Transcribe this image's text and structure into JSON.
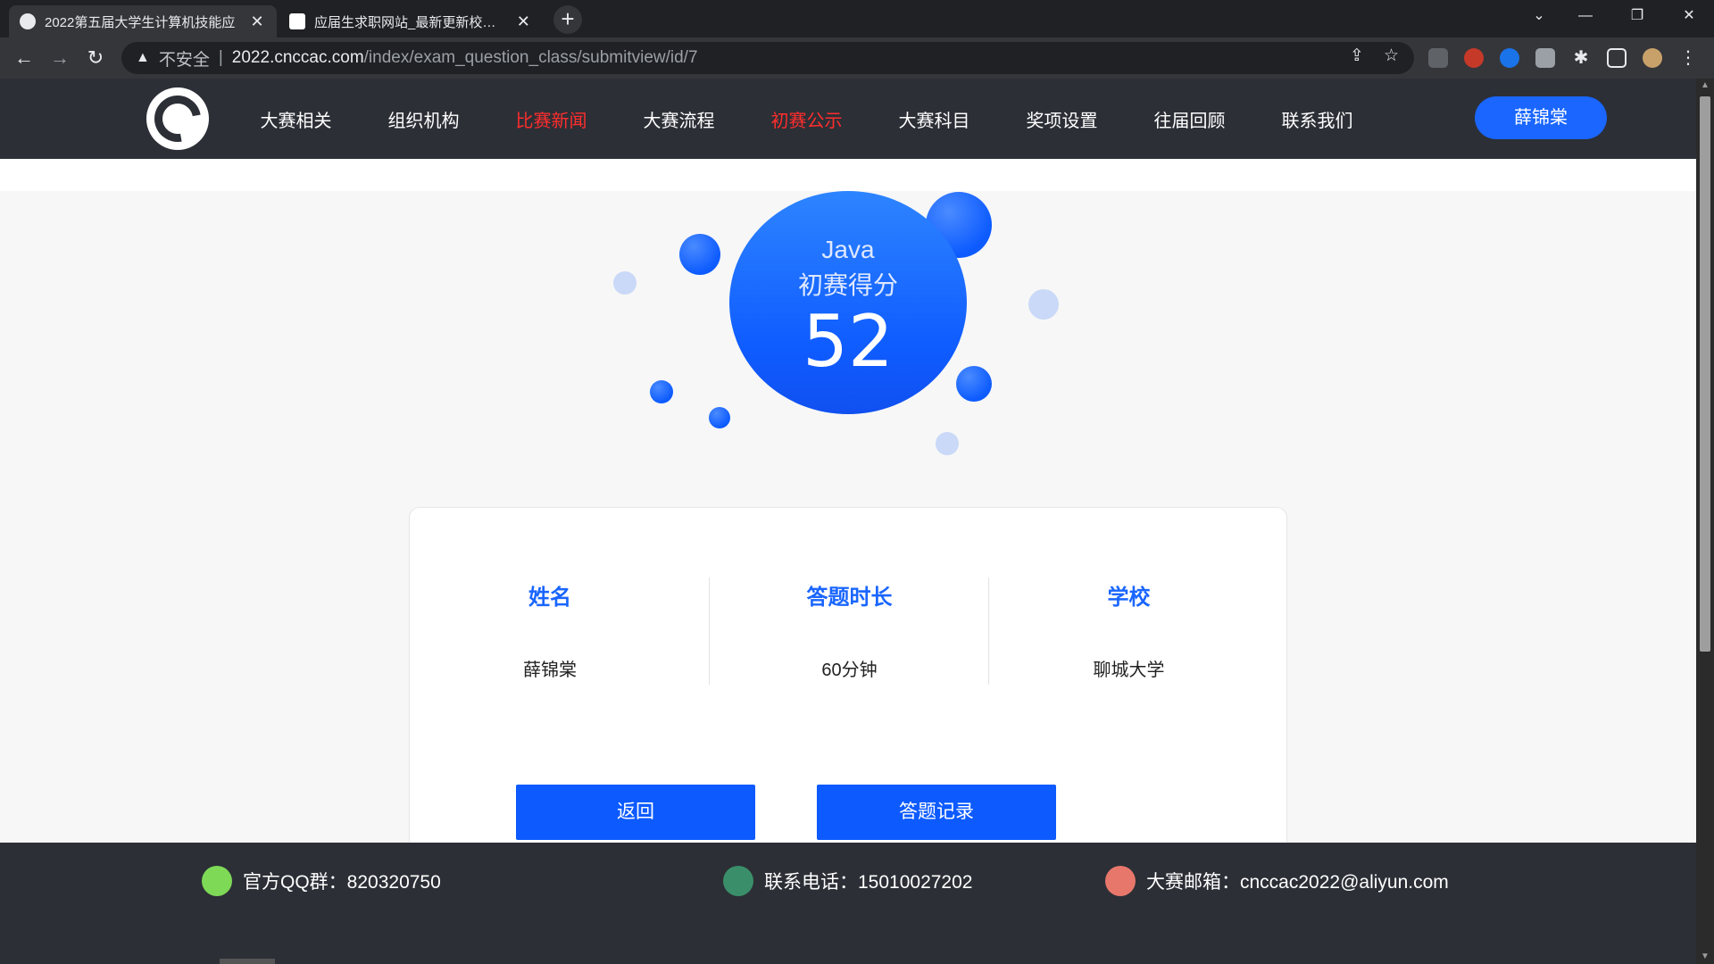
{
  "browser": {
    "tabs": [
      {
        "title": "2022第五届大学生计算机技能应",
        "active": true
      },
      {
        "title": "应届生求职网站_最新更新校园招",
        "active": false
      }
    ],
    "new_tab": "+",
    "address": {
      "warning_icon": "▲",
      "insecure_label": "不安全",
      "separator": "|",
      "host": "2022.cncca c.com",
      "host_text": "2022.cnccac.com",
      "path": "/index/exam_question_class/submitview/id/7"
    },
    "window_controls": {
      "chevron": "⌄",
      "minimize": "—",
      "restore": "❐",
      "close": "✕"
    }
  },
  "header": {
    "nav": [
      {
        "label": "大赛相关",
        "highlight": false
      },
      {
        "label": "组织机构",
        "highlight": false
      },
      {
        "label": "比赛新闻",
        "highlight": true
      },
      {
        "label": "大赛流程",
        "highlight": false
      },
      {
        "label": "初赛公示",
        "highlight": true
      },
      {
        "label": "大赛科目",
        "highlight": false
      },
      {
        "label": "奖项设置",
        "highlight": false
      },
      {
        "label": "往届回顾",
        "highlight": false
      },
      {
        "label": "联系我们",
        "highlight": false
      }
    ],
    "user": "薛锦棠"
  },
  "score": {
    "subject": "Java",
    "label": "初赛得分",
    "value": "52"
  },
  "info": {
    "columns": [
      {
        "head": "姓名",
        "value": "薛锦棠"
      },
      {
        "head": "答题时长",
        "value": "60分钟"
      },
      {
        "head": "学校",
        "value": "聊城大学"
      }
    ],
    "buttons": {
      "back": "返回",
      "records": "答题记录"
    }
  },
  "footer": {
    "qq": "官方QQ群：820320750",
    "phone": "联系电话：15010027202",
    "email": "大赛邮箱：cnccac2022@aliyun.com"
  },
  "colors": {
    "accent": "#1a66ff",
    "highlight_nav": "#ff2d2d",
    "header_bg": "#2c2f36"
  }
}
